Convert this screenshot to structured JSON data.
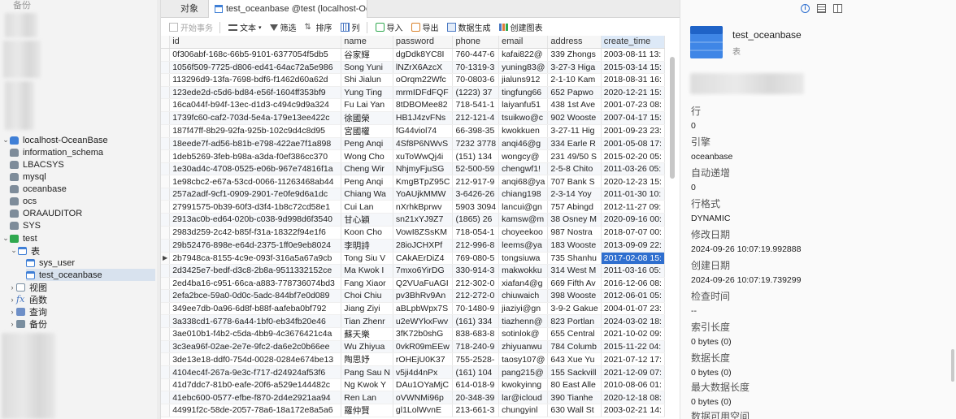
{
  "nav": {
    "top_partial": "备份",
    "connection": "localhost-OceanBase",
    "databases": [
      "information_schema",
      "LBACSYS",
      "mysql",
      "oceanbase",
      "ocs",
      "ORAAUDITOR",
      "SYS"
    ],
    "open_db": "test",
    "tables_group": "表",
    "tables": [
      "sys_user",
      "test_oceanbase"
    ],
    "groups": [
      "视图",
      "函数",
      "查询",
      "备份"
    ]
  },
  "tabs": {
    "object": "对象",
    "data": "test_oceanbase @test (localhost-Oc..."
  },
  "toolbar": {
    "begin_tx": "开始事务",
    "text": "文本",
    "filter": "筛选",
    "sort": "排序",
    "columns": "列",
    "import": "导入",
    "export": "导出",
    "data_gen": "数据生成",
    "create_chart": "创建图表"
  },
  "grid": {
    "columns": [
      "id",
      "name",
      "password",
      "phone",
      "email",
      "address",
      "create_time"
    ],
    "rows": [
      [
        "0f306abf-168c-66b5-9101-6377054f5db5",
        "谷家輝",
        "dgDdk8YC8I",
        "760-447-6",
        "kafai822@",
        "339 Zhongs",
        "2003-08-11 13:"
      ],
      [
        "1056f509-7725-d806-ed41-64ac72a5e986",
        "Song Yuni",
        "lNZrX6AzcX",
        "70-1319-3",
        "yuning83@",
        "3-27-3 Higa",
        "2015-03-14 15:"
      ],
      [
        "113296d9-13fa-7698-bdf6-f1462d60a62d",
        "Shi Jialun",
        "oOrqm22Wfc",
        "70-0803-6",
        "jialuns912",
        "2-1-10 Kam",
        "2018-08-31 16:"
      ],
      [
        "123ede2d-c5d6-bd84-e56f-1604ff353bf9",
        "Yung Ting",
        "mrmIDFdFQF",
        "(1223) 37",
        "tingfung66",
        "652 Papwo",
        "2020-12-21 15:"
      ],
      [
        "16ca044f-b94f-13ec-d1d3-c494c9d9a324",
        "Fu Lai Yan",
        "8tDBOMee82",
        "718-541-1",
        "laiyanfu51",
        "438 1st Ave",
        "2001-07-23 08:"
      ],
      [
        "1739fc60-caf2-703d-5e4a-179e13ee422c",
        "徐國榮",
        "HB1J4zvFNs",
        "212-121-4",
        "tsuikwo@c",
        "902 Wooste",
        "2007-04-17 15:"
      ],
      [
        "187f47ff-8b29-92fa-925b-102c9d4c8d95",
        "宮國權",
        "fG44viol74",
        "66-398-35",
        "kwokkuen",
        "3-27-11 Hig",
        "2001-09-23 23:"
      ],
      [
        "18eede7f-ad56-b81b-e798-422ae7f1a898",
        "Peng Anqi",
        "4Sf8P6NWvS",
        "7232 3778",
        "anqi46@g",
        "334 Earle R",
        "2001-05-08 17:"
      ],
      [
        "1deb5269-3feb-b98a-a3da-f0ef386cc370",
        "Wong Cho",
        "xuToWwQj4i",
        "(151) 134",
        "wongcy@",
        "231 49/50 S",
        "2015-02-20 05:"
      ],
      [
        "1e30ad4c-4708-0525-e06b-967e74816f1a",
        "Cheng Wir",
        "NhjmyFjuSG",
        "52-500-59",
        "chengwf1!",
        "2-5-8 Chito",
        "2011-03-26 05:"
      ],
      [
        "1e98cbc2-e67a-53cd-0066-11263468ab44",
        "Peng Anqi",
        "KmgBTpZ95C",
        "212-917-9",
        "anqi68@ya",
        "707 Bank S",
        "2020-12-23 15:"
      ],
      [
        "257a2adf-9cf1-0909-2901-7e0fe9d6a1dc",
        "Chiang Wa",
        "YoAUjkMMW",
        "3-6426-26",
        "chiang198",
        "2-3-14 Yoy",
        "2011-01-30 10:"
      ],
      [
        "27991575-0b39-60f3-d3f4-1b8c72cd58e1",
        "Cui Lan",
        "nXrhkBprwv",
        "5903 3094",
        "lancui@gn",
        "757 Abingd",
        "2012-11-27 09:"
      ],
      [
        "2913ac0b-ed64-020b-c038-9d998d6f3540",
        "甘心穎",
        "sn21xYJ9Z7",
        "(1865) 26",
        "kamsw@m",
        "38 Osney M",
        "2020-09-16 00:"
      ],
      [
        "2983d259-2c42-b85f-f31a-18322f94e1f6",
        "Koon Cho",
        "VowI8ZSsKM",
        "718-054-1",
        "choyeekoo",
        "987 Nostra",
        "2018-07-07 00:"
      ],
      [
        "29b52476-898e-e64d-2375-1ff0e9eb8024",
        "李明詩",
        "28ioJCHXPf",
        "212-996-8",
        "leems@ya",
        "183 Wooste",
        "2013-09-09 22:"
      ],
      [
        "2b7948ca-8155-4c9e-093f-316a5a67a9cb",
        "Tong Siu V",
        "CAkAErDiZ4",
        "769-080-5",
        "tongsiuwa",
        "735 Shanhu",
        "2017-02-08 15:"
      ],
      [
        "2d3425e7-bedf-d3c8-2b8a-9511332152ce",
        "Ma Kwok I",
        "7mxo6YirDG",
        "330-914-3",
        "makwokku",
        "314 West M",
        "2011-03-16 05:"
      ],
      [
        "2ed4ba16-c951-66ca-a883-778736074bd3",
        "Fang Xiaor",
        "Q2VUaFuAGI",
        "212-302-0",
        "xiafan4@g",
        "669 Fifth Av",
        "2016-12-06 08:"
      ],
      [
        "2efa2bce-59a0-0d0c-5adc-844bf7e0d089",
        "Choi Chiu",
        "pv3BhRv9An",
        "212-272-0",
        "chiuwaich",
        "398 Wooste",
        "2012-06-01 05:"
      ],
      [
        "349ee7db-0a96-6d8f-b88f-aafeba0bf792",
        "Jiang Ziyi",
        "aBLpbWpx7S",
        "70-1480-9",
        "jiaziyi@gn",
        "3-9-2 Gakue",
        "2004-01-07 23:"
      ],
      [
        "3a338cd1-6778-6a44-1bf0-eb34fb20e46",
        "Tian Zhenr",
        "u2eWYkxFwv",
        "(161) 334",
        "tiazhenn@",
        "823 Portlan",
        "2024-03-02 18:"
      ],
      [
        "3ae010b1-f4b2-c5da-4bb9-4c3676421c4a",
        "蘇天樂",
        "3fK72b0shG",
        "838-683-8",
        "sotinlok@",
        "655 Central",
        "2021-10-02 09:"
      ],
      [
        "3c3ea96f-02ae-2e7e-9fc2-da6e2c0b66ee",
        "Wu Zhiyua",
        "0vkR09mEEw",
        "718-240-9",
        "zhiyuanwu",
        "784 Columb",
        "2015-11-22 04:"
      ],
      [
        "3de13e18-ddf0-754d-0028-0284e674be13",
        "陶思妤",
        "rOHEjU0K37",
        "755-2528-",
        "taosy107@",
        "643 Xue Yu",
        "2021-07-12 17:"
      ],
      [
        "4104ec4f-267a-9e3c-f717-d24924af53f6",
        "Pang Sau N",
        "v5ji4d4nPx",
        "(161) 104",
        "pang215@",
        "155 Sackvill",
        "2021-12-09 07:"
      ],
      [
        "41d7ddc7-81b0-eafe-20f6-a529e144482c",
        "Ng Kwok Y",
        "DAu1OYaMjC",
        "614-018-9",
        "kwokyinng",
        "80 East Alle",
        "2010-08-06 01:"
      ],
      [
        "41ebc600-0577-efbe-f870-2d4e2921aa94",
        "Ren Lan",
        "oVWNMi96p",
        "20-348-39",
        "lar@icloud",
        "390 Tianhe",
        "2020-12-18 08:"
      ],
      [
        "44991f2c-58de-2057-78a6-18a172e8a5a6",
        "羅仲賢",
        "gl1LolWvnE",
        "213-661-3",
        "chungyinl",
        "630 Wall St",
        "2003-02-21 14:"
      ]
    ]
  },
  "info": {
    "name": "test_oceanbase",
    "type": "表",
    "fields": [
      {
        "label": "行",
        "value": "0"
      },
      {
        "label": "引擎",
        "value": "oceanbase"
      },
      {
        "label": "自动递增",
        "value": "0"
      },
      {
        "label": "行格式",
        "value": "DYNAMIC"
      },
      {
        "label": "修改日期",
        "value": "2024-09-26 10:07:19.992888"
      },
      {
        "label": "创建日期",
        "value": "2024-09-26 10:07:19.739299"
      },
      {
        "label": "检查时间",
        "value": "--"
      },
      {
        "label": "索引长度",
        "value": "0 bytes (0)"
      },
      {
        "label": "数据长度",
        "value": "0 bytes (0)"
      },
      {
        "label": "最大数据长度",
        "value": "0 bytes (0)"
      },
      {
        "label": "数据可用空间",
        "value": ""
      }
    ]
  },
  "colors": {
    "accent": "#2f6fcf",
    "selected_tree": "#d8e2ee",
    "header_active": "#dde9f7"
  }
}
